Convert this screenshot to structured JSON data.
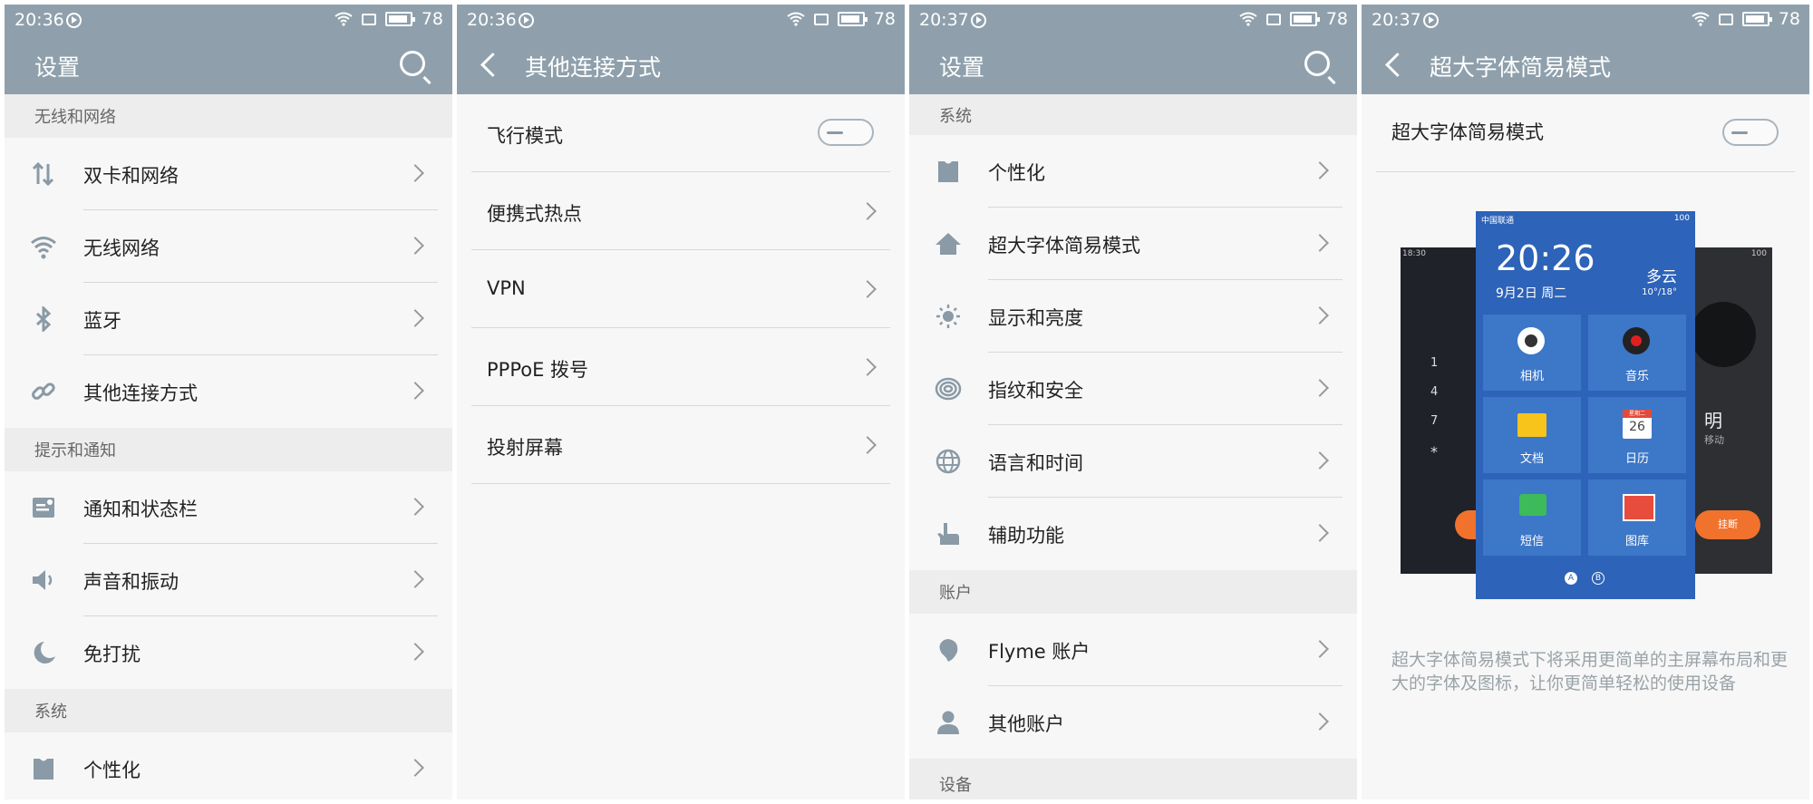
{
  "status": [
    {
      "time": "20:36",
      "battery": "78"
    },
    {
      "time": "20:36",
      "battery": "78"
    },
    {
      "time": "20:37",
      "battery": "78"
    },
    {
      "time": "20:37",
      "battery": "78"
    }
  ],
  "panel1": {
    "title": "设置",
    "sections": [
      {
        "header": "无线和网络",
        "items": [
          {
            "label": "双卡和网络",
            "icon": "dual-sim-icon"
          },
          {
            "label": "无线网络",
            "icon": "wifi-icon"
          },
          {
            "label": "蓝牙",
            "icon": "bluetooth-icon"
          },
          {
            "label": "其他连接方式",
            "icon": "link-icon"
          }
        ]
      },
      {
        "header": "提示和通知",
        "items": [
          {
            "label": "通知和状态栏",
            "icon": "notification-icon"
          },
          {
            "label": "声音和振动",
            "icon": "speaker-icon"
          },
          {
            "label": "免打扰",
            "icon": "moon-icon"
          }
        ]
      },
      {
        "header": "系统",
        "items": [
          {
            "label": "个性化",
            "icon": "personalize-icon"
          }
        ]
      }
    ]
  },
  "panel2": {
    "title": "其他连接方式",
    "toggle_item": "飞行模式",
    "items": [
      "便携式热点",
      "VPN",
      "PPPoE 拨号",
      "投射屏幕"
    ]
  },
  "panel3": {
    "title": "设置",
    "sections": [
      {
        "header": "系统",
        "items": [
          {
            "label": "个性化",
            "icon": "personalize-icon"
          },
          {
            "label": "超大字体简易模式",
            "icon": "home-icon"
          },
          {
            "label": "显示和亮度",
            "icon": "brightness-icon"
          },
          {
            "label": "指纹和安全",
            "icon": "fingerprint-icon"
          },
          {
            "label": "语言和时间",
            "icon": "globe-icon"
          },
          {
            "label": "辅助功能",
            "icon": "hand-icon"
          }
        ]
      },
      {
        "header": "账户",
        "items": [
          {
            "label": "Flyme 账户",
            "icon": "flyme-icon"
          },
          {
            "label": "其他账户",
            "icon": "user-icon"
          }
        ]
      },
      {
        "header": "设备",
        "items": []
      }
    ]
  },
  "panel4": {
    "title": "超大字体简易模式",
    "toggle_item": "超大字体简易模式",
    "description": "超大字体简易模式下将采用更简单的主屏幕布局和更大的字体及图标，让你更简单轻松的使用设备",
    "preview": {
      "carrier": "中国联通",
      "battery": "100",
      "clock": "20:26",
      "date": "9月2日 周二",
      "weather": "多云",
      "temp": "10°/18°",
      "left_time": "18:30",
      "right_battery": "100",
      "keypad": [
        "1",
        "4",
        "7",
        "*"
      ],
      "right_partial": "明",
      "right_sub": "移动",
      "hangup": "挂断",
      "calendar_day": "26",
      "calendar_head": "星期二",
      "tiles": [
        "相机",
        "音乐",
        "文档",
        "日历",
        "短信",
        "图库"
      ],
      "pages": [
        "A",
        "B"
      ]
    }
  },
  "colors": {
    "header": "#8fa0ac",
    "icon": "#8a9aa6",
    "background": "#f7f7f7"
  }
}
